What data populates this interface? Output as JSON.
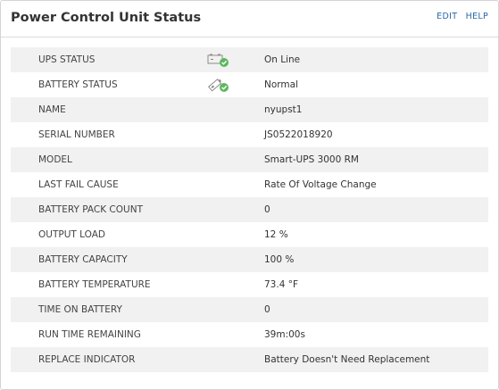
{
  "panel": {
    "title": "Power Control Unit Status",
    "links": {
      "edit": "EDIT",
      "help": "HELP"
    }
  },
  "colors": {
    "ok": "#5cb85c",
    "link": "#2a6aa6",
    "row_alt": "#f1f1f1"
  },
  "rows": [
    {
      "label": "UPS STATUS",
      "value": "On Line",
      "icon": "ups-ok-icon"
    },
    {
      "label": "BATTERY STATUS",
      "value": "Normal",
      "icon": "battery-ok-icon"
    },
    {
      "label": "NAME",
      "value": "nyupst1"
    },
    {
      "label": "SERIAL NUMBER",
      "value": "JS0522018920"
    },
    {
      "label": "MODEL",
      "value": "Smart-UPS 3000 RM"
    },
    {
      "label": "LAST FAIL CAUSE",
      "value": "Rate Of Voltage Change"
    },
    {
      "label": "BATTERY PACK COUNT",
      "value": "0"
    },
    {
      "label": "OUTPUT LOAD",
      "value": "12 %"
    },
    {
      "label": "BATTERY CAPACITY",
      "value": "100 %"
    },
    {
      "label": "BATTERY TEMPERATURE",
      "value": "73.4 °F"
    },
    {
      "label": "TIME ON BATTERY",
      "value": "0"
    },
    {
      "label": "RUN TIME REMAINING",
      "value": "39m:00s"
    },
    {
      "label": "REPLACE INDICATOR",
      "value": "Battery Doesn't Need Replacement"
    }
  ]
}
